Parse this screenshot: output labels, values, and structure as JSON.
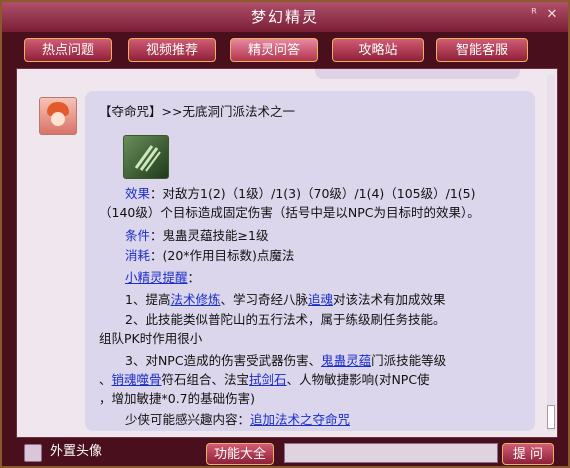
{
  "window": {
    "title": "梦幻精灵"
  },
  "tabs": [
    {
      "label": "热点问题"
    },
    {
      "label": "视频推荐"
    },
    {
      "label": "精灵问答"
    },
    {
      "label": "攻略站"
    },
    {
      "label": "智能客服"
    }
  ],
  "active_tab": "精灵问答",
  "message": {
    "header_tag": "【夺命咒】",
    "header_path": ">>无底洞门派法术之一",
    "effect_label": "效果",
    "effect_line1": "：对敌方1(2)（1级）/1(3)（70级）/1(4)（105级）/1(5)",
    "effect_line2": "（140级）个目标造成固定伤害（括号中是以NPC为目标时的效果）。",
    "condition_label": "条件",
    "condition_text": "：鬼蛊灵蕴技能≥1级",
    "cost_label": "消耗",
    "cost_text": "：(20*作用目标数)点魔法",
    "tip_title": "小精灵提醒",
    "tip_colon": "：",
    "tip1_a": "1、提高",
    "tip1_link1": "法术修炼",
    "tip1_b": "、学习奇经八脉",
    "tip1_link2": "追魂",
    "tip1_c": "对该法术有加成效果",
    "tip2_line1": "2、此技能类似普陀山的五行法术，属于练级刷任务技能。",
    "tip2_line2": "组队PK时作用很小",
    "tip3_a": "3、对NPC造成的伤害受武器伤害、",
    "tip3_link1": "鬼蛊灵蕴",
    "tip3_b": "门派技能等级",
    "tip3_c": "、",
    "tip3_link2": "销魂噬骨",
    "tip3_d": "符石组合、法宝",
    "tip3_link3": "拭剑石",
    "tip3_e": "、人物敏捷影响(对NPC使",
    "tip3_f": "，增加敏捷*0.7的基础伤害)",
    "related_label": "少侠可能感兴趣内容：",
    "related_link": "追加法术之夺命咒"
  },
  "footer": {
    "custom_avatar_label": "外置头像",
    "feature_button": "功能大全",
    "ask_button": "提 问",
    "input_value": ""
  },
  "icons": [
    "minimize-icon",
    "close-icon",
    "skill-claw-icon",
    "gem-cursor-icon",
    "avatar"
  ],
  "colors": {
    "accent": "#8e1f38",
    "link": "#1a2ec9",
    "bubble": "#dcd6ec"
  }
}
